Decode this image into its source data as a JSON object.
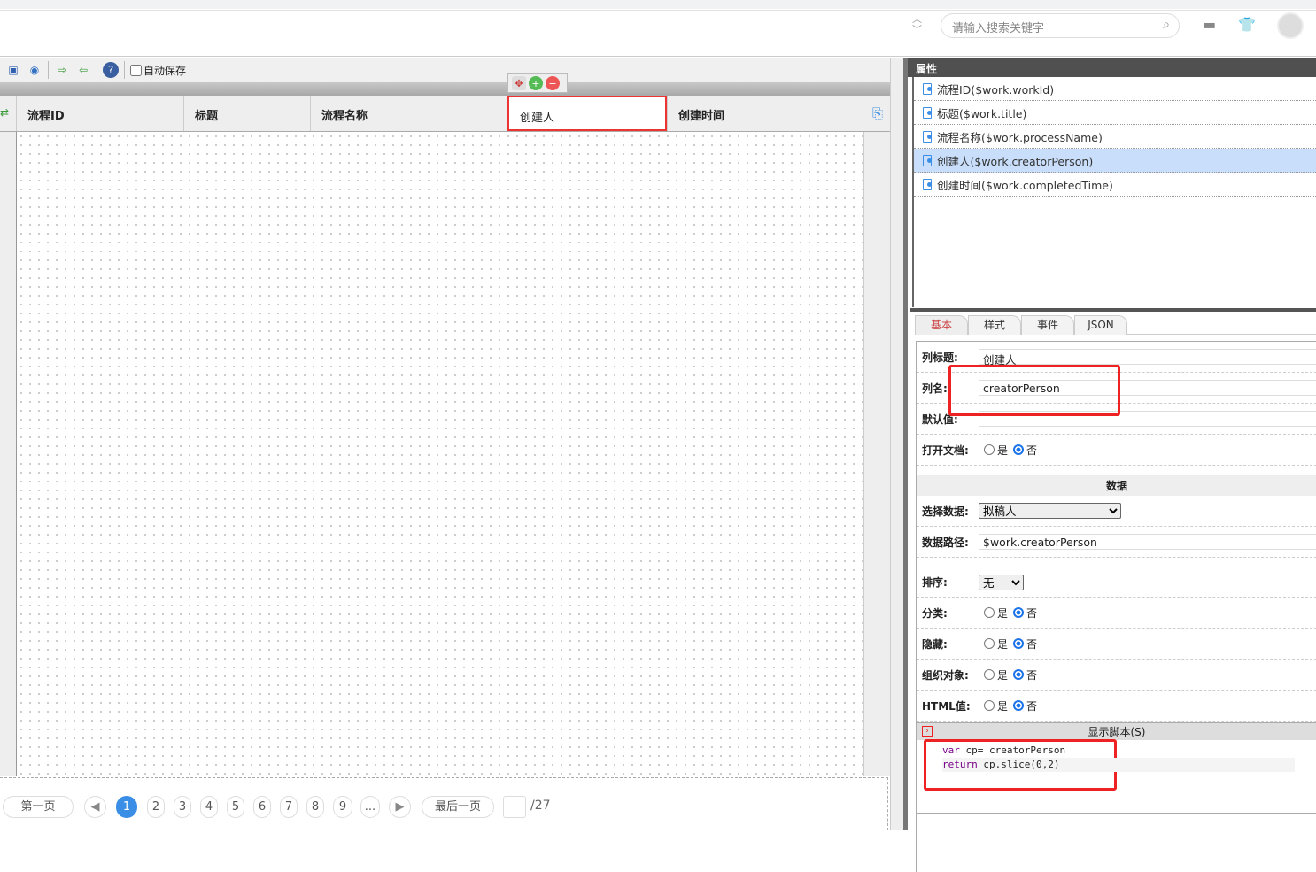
{
  "header": {
    "search_placeholder": "请输入搜索关键字"
  },
  "toolbar": {
    "autosave_label": "自动保存"
  },
  "grid": {
    "columns": [
      "流程ID",
      "标题",
      "流程名称",
      "创建人",
      "创建时间"
    ]
  },
  "pagination": {
    "first": "第一页",
    "last": "最后一页",
    "pages": [
      "1",
      "2",
      "3",
      "4",
      "5",
      "6",
      "7",
      "8",
      "9",
      "..."
    ],
    "current": "1",
    "total": "/27"
  },
  "panel": {
    "title": "属性",
    "properties": [
      "流程ID($work.workId)",
      "标题($work.title)",
      "流程名称($work.processName)",
      "创建人($work.creatorPerson)",
      "创建时间($work.completedTime)"
    ],
    "tabs": [
      "基本",
      "样式",
      "事件",
      "JSON"
    ],
    "form": {
      "col_title_label": "列标题:",
      "col_title": "创建人",
      "col_name_label": "列名:",
      "col_name": "creatorPerson",
      "default_label": "默认值:",
      "default_value": "",
      "open_doc_label": "打开文档:",
      "yes": "是",
      "no": "否",
      "data_section": "数据",
      "select_data_label": "选择数据:",
      "select_data": "拟稿人",
      "data_path_label": "数据路径:",
      "data_path": "$work.creatorPerson",
      "sort_label": "排序:",
      "sort": "无",
      "category_label": "分类:",
      "hidden_label": "隐藏:",
      "org_label": "组织对象:",
      "html_label": "HTML值:",
      "script_section": "显示脚本(S)",
      "code_line1_kw": "var",
      "code_line1": " cp= creatorPerson",
      "code_line2_kw": "return",
      "code_line2": " cp.slice(0,2)"
    }
  }
}
